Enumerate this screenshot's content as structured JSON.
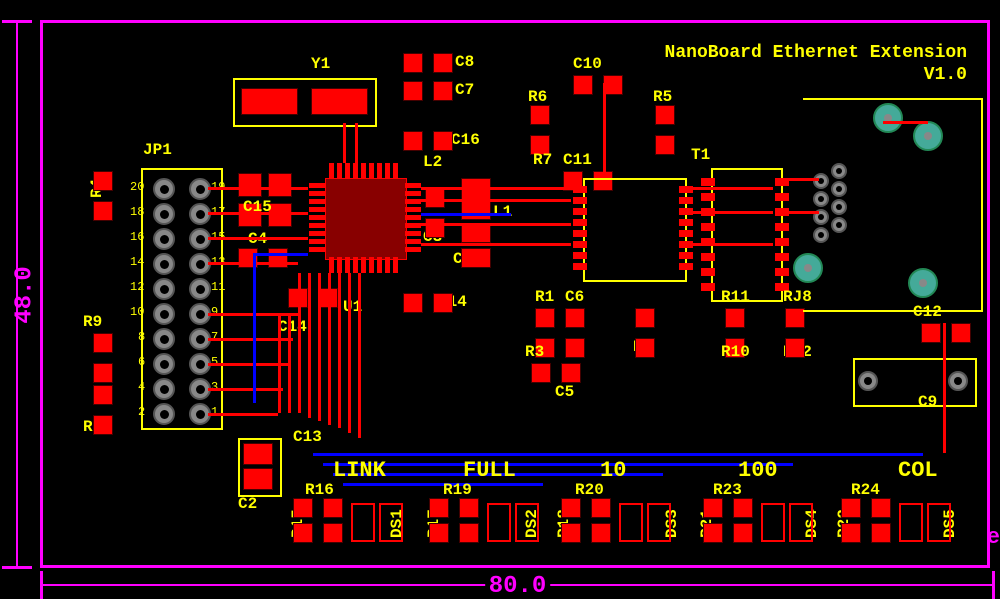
{
  "board": {
    "title1": "NanoBoard Ethernet Extension",
    "title2": "V1.0",
    "dim_v": "48.0",
    "dim_h": "80.0",
    "legend_suffix": ".Le"
  },
  "designators": {
    "y1": "Y1",
    "jp1": "JP1",
    "u1": "U1",
    "t1": "T1",
    "l1": "L1",
    "l2": "L2",
    "c1": "C1",
    "c2": "C2",
    "c3": "C3",
    "c4": "C4",
    "c5": "C5",
    "c6": "C6",
    "c7": "C7",
    "c8": "C8",
    "c9": "C9",
    "c10": "C10",
    "c11": "C11",
    "c12": "C12",
    "c13": "C13",
    "c14": "C14",
    "c15": "C15",
    "c16": "C16",
    "r1": "R1",
    "r2": "R2",
    "r3": "R3",
    "r4": "R4",
    "r5": "R5",
    "r6": "R6",
    "r7": "R7",
    "r8": "R8",
    "r9": "R9",
    "r10": "R10",
    "r11": "R11",
    "r12": "R12",
    "r13": "RJ8",
    "r14": "R14",
    "r15": "R15",
    "r16": "R16",
    "r17": "R17",
    "r18": "R18",
    "r19": "R19",
    "r20": "R20",
    "r21": "R21",
    "r22": "R22",
    "r23": "R23",
    "r24": "R24",
    "ds1": "DS1",
    "ds2": "DS2",
    "ds3": "DS3",
    "ds4": "DS4",
    "ds5": "DS5"
  },
  "led_labels": {
    "link": "LINK",
    "full": "FULL",
    "ten": "10",
    "hundred": "100",
    "col": "COL"
  },
  "pin_numbers": [
    "1",
    "2",
    "3",
    "4",
    "5",
    "6",
    "7",
    "8",
    "9",
    "10",
    "11",
    "12",
    "13",
    "14",
    "15",
    "16",
    "17",
    "18",
    "19",
    "20"
  ],
  "colors": {
    "top_copper": "#ff0000",
    "bottom_copper": "#0000ff",
    "silkscreen": "#ffff00",
    "board_outline": "#ff00ff",
    "drill": "#888888"
  }
}
